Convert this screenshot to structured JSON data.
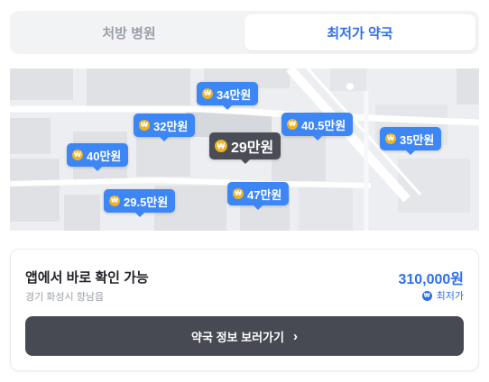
{
  "tabs": [
    {
      "label": "처방 병원",
      "active": false
    },
    {
      "label": "최저가 약국",
      "active": true
    }
  ],
  "map": {
    "coin_icon": "won-coin-icon",
    "pins": [
      {
        "label": "34만원",
        "highlight": false
      },
      {
        "label": "32만원",
        "highlight": false
      },
      {
        "label": "40.5만원",
        "highlight": false
      },
      {
        "label": "35만원",
        "highlight": false
      },
      {
        "label": "40만원",
        "highlight": false
      },
      {
        "label": "29만원",
        "highlight": true
      },
      {
        "label": "47만원",
        "highlight": false
      },
      {
        "label": "29.5만원",
        "highlight": false
      }
    ]
  },
  "card": {
    "title": "앱에서 바로 확인 가능",
    "address": "경기 화성시 향남읍",
    "price": "310,000원",
    "badge": "최저가",
    "cta_label": "약국 정보 보러가기"
  },
  "colors": {
    "accent": "#2f6fea",
    "pin": "#3d86f5",
    "pin_selected": "#4a4d55",
    "coin": "#f2b21f",
    "cta": "#474a52"
  }
}
